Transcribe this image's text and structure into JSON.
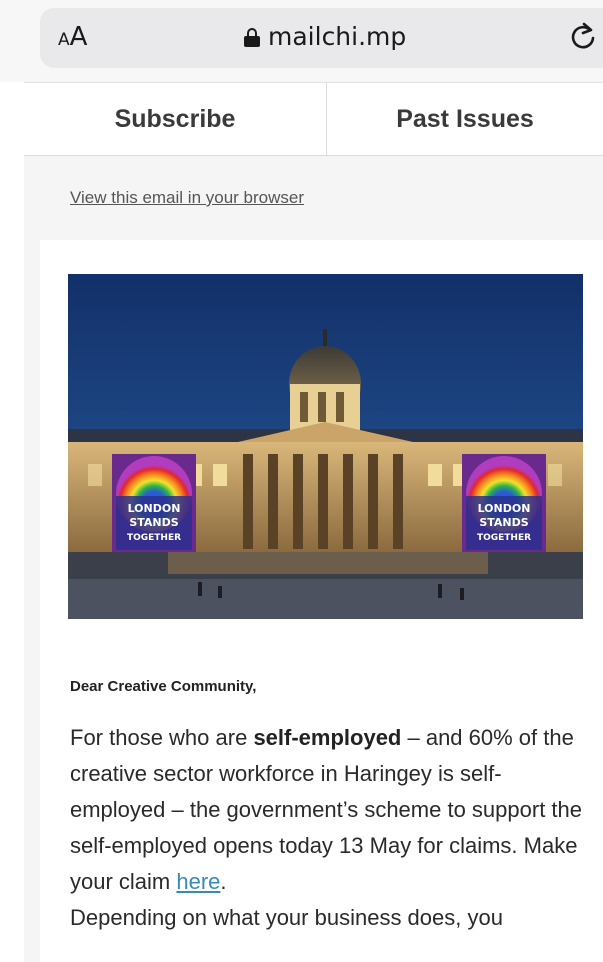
{
  "browser": {
    "text_size_label_small": "A",
    "text_size_label_large": "A",
    "url": "mailchi.mp"
  },
  "nav": {
    "subscribe": "Subscribe",
    "past_issues": "Past Issues"
  },
  "email": {
    "view_in_browser": "View this email in your browser",
    "hero_banner_text": [
      "LONDON",
      "STANDS",
      "TOGETHER"
    ],
    "greeting": "Dear Creative Community,",
    "p1_a": "For those who are ",
    "p1_bold": "self-employed",
    "p1_b": " – and 60% of the creative sector workforce in Haringey is self-employed – the government’s scheme to support the self-employed opens today 13 May for claims. Make your claim ",
    "p1_link": "here",
    "p1_end": ".",
    "p2": "Depending on what your business does, you"
  },
  "colors": {
    "link": "#3a8ab8",
    "sky": "#1f4e8c",
    "building": "#c9a36a"
  },
  "icons": {
    "lock": "lock-icon",
    "reload": "reload-icon"
  }
}
